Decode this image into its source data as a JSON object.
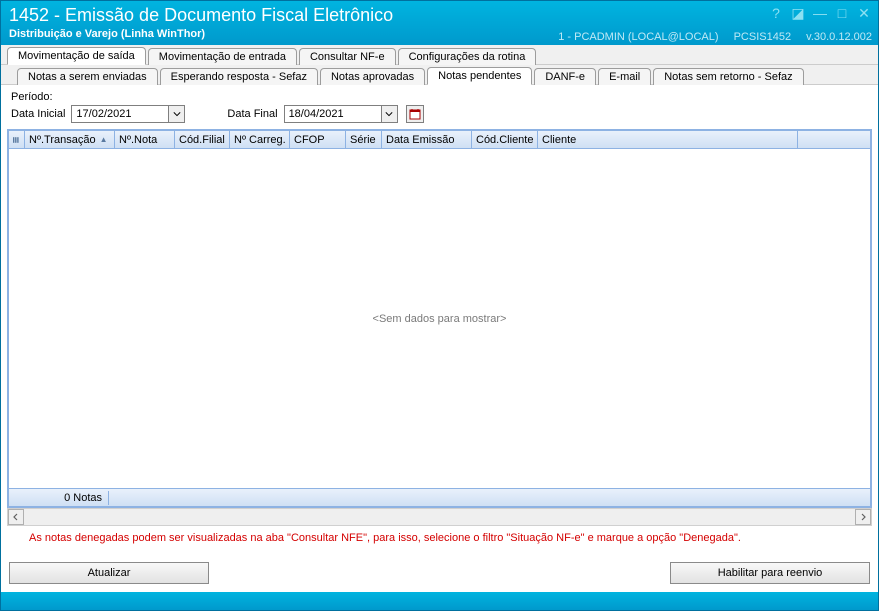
{
  "titlebar": {
    "title": "1452 - Emissão de Documento Fiscal Eletrônico",
    "subtitle": "Distribuição e Varejo (Linha WinThor)",
    "status_user": "1 - PCADMIN (LOCAL@LOCAL)",
    "status_module": "PCSIS1452",
    "status_version": "v.30.0.12.002"
  },
  "tabs_row1": [
    "Movimentação de saída",
    "Movimentação de entrada",
    "Consultar NF-e",
    "Configurações da rotina"
  ],
  "tabs_row1_active": 0,
  "tabs_row2": [
    "Notas a serem enviadas",
    "Esperando resposta - Sefaz",
    "Notas aprovadas",
    "Notas pendentes",
    "DANF-e",
    "E-mail",
    "Notas sem retorno - Sefaz"
  ],
  "tabs_row2_active": 3,
  "period": {
    "label": "Período:",
    "initial_label": "Data Inicial",
    "initial_value": "17/02/2021",
    "final_label": "Data Final",
    "final_value": "18/04/2021"
  },
  "grid": {
    "columns": [
      "Nº.Transação",
      "Nº.Nota",
      "Cód.Filial",
      "Nº Carreg.",
      "CFOP",
      "Série",
      "Data Emissão",
      "Cód.Cliente",
      "Cliente"
    ],
    "widths": [
      90,
      60,
      55,
      60,
      56,
      36,
      90,
      66,
      260
    ],
    "sort_column": 0,
    "empty_text": "<Sem dados para mostrar>",
    "footer_count": "0 Notas"
  },
  "info_text": "As notas denegadas podem ser visualizadas na aba \"Consultar NFE\", para isso, selecione o filtro \"Situação NF-e\" e marque a opção \"Denegada\".",
  "buttons": {
    "update": "Atualizar",
    "resend": "Habilitar para reenvio"
  }
}
